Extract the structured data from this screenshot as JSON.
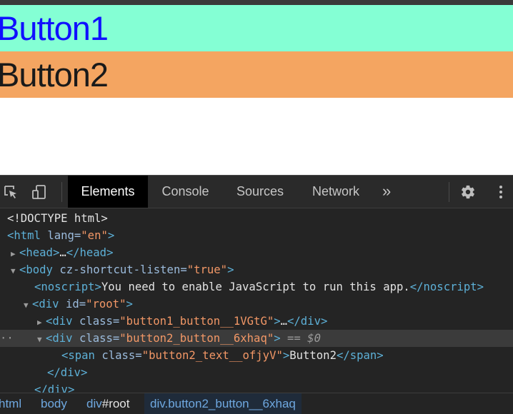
{
  "page": {
    "button1": "Button1",
    "button2": "Button2"
  },
  "devtools": {
    "tabs": [
      "Elements",
      "Console",
      "Sources",
      "Network"
    ],
    "more": "»",
    "dom": {
      "doctype": "<!DOCTYPE html>",
      "html_open": "<html",
      "html_attr": "lang",
      "html_val": "\"en\"",
      "head": "<head>",
      "head_close": "</head>",
      "ellipsis": "…",
      "body_open": "<body",
      "body_attr": "cz-shortcut-listen",
      "body_val": "\"true\"",
      "noscript_open": "<noscript>",
      "noscript_text": "You need to enable JavaScript to run this app.",
      "noscript_close": "</noscript>",
      "div_open": "<div",
      "id_attr": "id",
      "root_val": "\"root\"",
      "class_attr": "class",
      "btn1_class": "\"button1_button__1VGtG\"",
      "div_close": "</div>",
      "btn2_class": "\"button2_button__6xhaq\"",
      "selected_marker": "== $0",
      "span_open": "<span",
      "span_class": "\"button2_text__ofjyV\"",
      "span_text": "Button2",
      "span_close": "</span>",
      "cutoff": "</div>"
    },
    "breadcrumb": {
      "html": "html",
      "body": "body",
      "div_tag": "div",
      "div_id": "#root",
      "selected": "div.button2_button__6xhaq"
    }
  },
  "colors": {
    "button1_bg": "#84ffd4",
    "button1_text": "#1010ff",
    "button2_bg": "#f4a561",
    "devtools_bg": "#242424",
    "tag": "#5db0d7",
    "attr_value": "#f29766"
  },
  "icons": [
    "inspect-element-icon",
    "device-toolbar-icon",
    "settings-gear-icon",
    "more-options-icon"
  ]
}
